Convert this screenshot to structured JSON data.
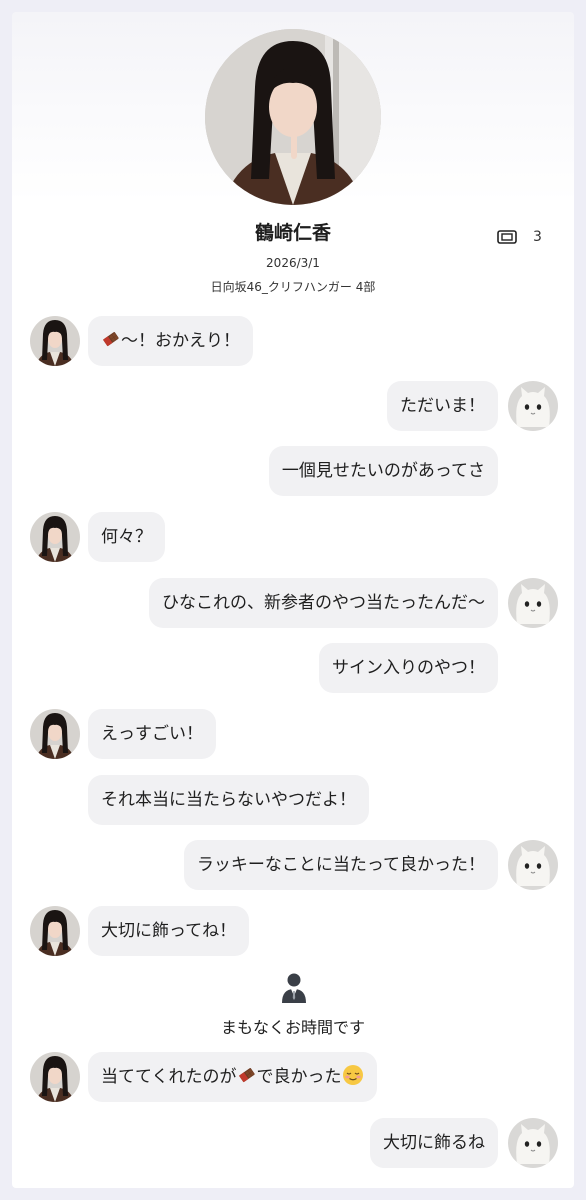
{
  "profile": {
    "name": "鶴崎仁香",
    "date": "2026/3/1",
    "group": "日向坂46_クリフハンガー 4部",
    "ticket_icon": "ticket-icon",
    "ticket_count": "3"
  },
  "messages": [
    {
      "side": "left",
      "pre": "",
      "emoji1": "chocolate",
      "mid": "〜！おかえり！",
      "emoji2": "",
      "post": ""
    },
    {
      "side": "right",
      "pre": "ただいま！",
      "emoji1": "",
      "mid": "",
      "emoji2": "",
      "post": ""
    },
    {
      "side": "right",
      "pre": "一個見せたいのがあってさ",
      "emoji1": "",
      "mid": "",
      "emoji2": "",
      "post": ""
    },
    {
      "side": "left",
      "pre": "何々？",
      "emoji1": "",
      "mid": "",
      "emoji2": "",
      "post": ""
    },
    {
      "side": "right",
      "pre": "ひなこれの、新参者のやつ当たったんだ〜",
      "emoji1": "",
      "mid": "",
      "emoji2": "",
      "post": ""
    },
    {
      "side": "right",
      "pre": "サイン入りのやつ！",
      "emoji1": "",
      "mid": "",
      "emoji2": "",
      "post": ""
    },
    {
      "side": "left",
      "pre": "えっすごい！",
      "emoji1": "",
      "mid": "",
      "emoji2": "",
      "post": ""
    },
    {
      "side": "left",
      "pre": "それ本当に当たらないやつだよ！",
      "emoji1": "",
      "mid": "",
      "emoji2": "",
      "post": ""
    },
    {
      "side": "right",
      "pre": "ラッキーなことに当たって良かった！",
      "emoji1": "",
      "mid": "",
      "emoji2": "",
      "post": ""
    },
    {
      "side": "left",
      "pre": "大切に飾ってね！",
      "emoji1": "",
      "mid": "",
      "emoji2": "",
      "post": ""
    },
    {
      "side": "left",
      "pre": "当ててくれたのが",
      "emoji1": "chocolate",
      "mid": "で良かった",
      "emoji2": "relieved-smile",
      "post": ""
    },
    {
      "side": "right",
      "pre": "大切に飾るね",
      "emoji1": "",
      "mid": "",
      "emoji2": "",
      "post": ""
    }
  ],
  "system_notice": {
    "icon": "staff-person-icon",
    "text": "まもなくお時間です"
  },
  "colors": {
    "bubble": "#f1f1f3",
    "background": "#eeeef6",
    "card": "#ffffff"
  }
}
